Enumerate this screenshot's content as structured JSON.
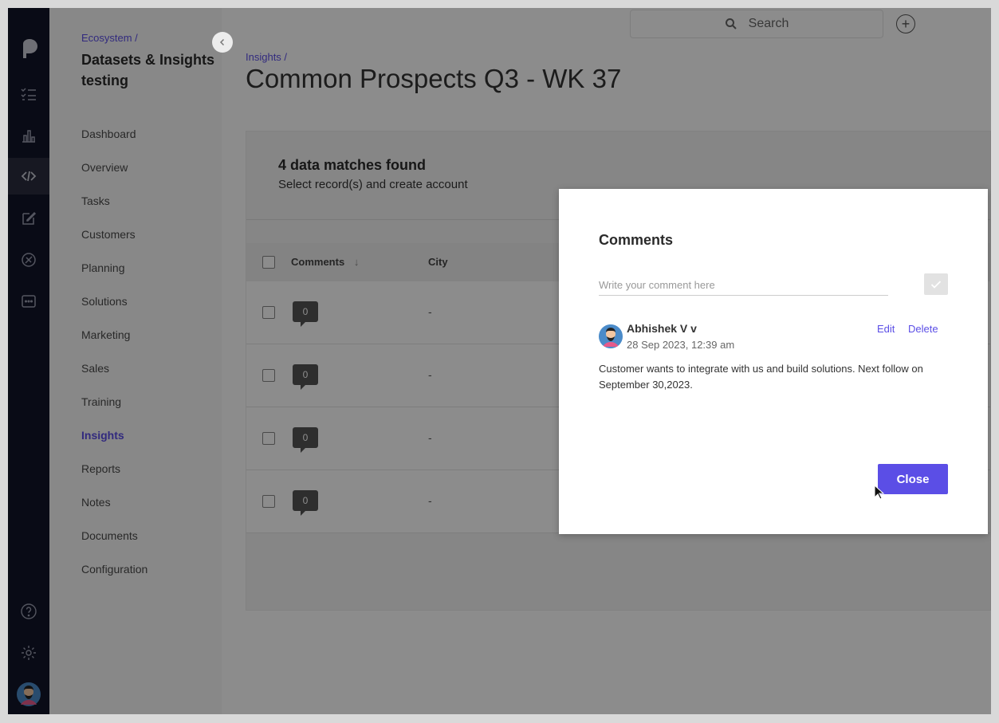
{
  "sidebar": {
    "breadcrumb": "Ecosystem /",
    "workspace_title": "Datasets & Insights testing",
    "items": [
      {
        "label": "Dashboard"
      },
      {
        "label": "Overview"
      },
      {
        "label": "Tasks"
      },
      {
        "label": "Customers"
      },
      {
        "label": "Planning"
      },
      {
        "label": "Solutions"
      },
      {
        "label": "Marketing"
      },
      {
        "label": "Sales"
      },
      {
        "label": "Training"
      },
      {
        "label": "Insights",
        "active": true
      },
      {
        "label": "Reports"
      },
      {
        "label": "Notes"
      },
      {
        "label": "Documents"
      },
      {
        "label": "Configuration"
      }
    ]
  },
  "header": {
    "search_label": "Search"
  },
  "main": {
    "breadcrumb": "Insights /",
    "title": "Common Prospects Q3 - WK 37",
    "matches_title": "4 data matches found",
    "matches_subtitle": "Select record(s) and create account",
    "columns": [
      "Comments",
      "City"
    ],
    "rows": [
      {
        "comments": "0",
        "city": "-"
      },
      {
        "comments": "0",
        "city": "-"
      },
      {
        "comments": "0",
        "city": "-"
      },
      {
        "comments": "0",
        "city": "-"
      }
    ]
  },
  "modal": {
    "title": "Comments",
    "input_placeholder": "Write your comment here",
    "comment": {
      "author": "Abhishek V v",
      "timestamp": "28 Sep 2023, 12:39 am",
      "text": "Customer wants to integrate with us and build solutions. Next follow on September 30,2023.",
      "edit_label": "Edit",
      "delete_label": "Delete"
    },
    "close_label": "Close"
  },
  "colors": {
    "accent": "#5b4ee6",
    "rail": "#121528"
  }
}
